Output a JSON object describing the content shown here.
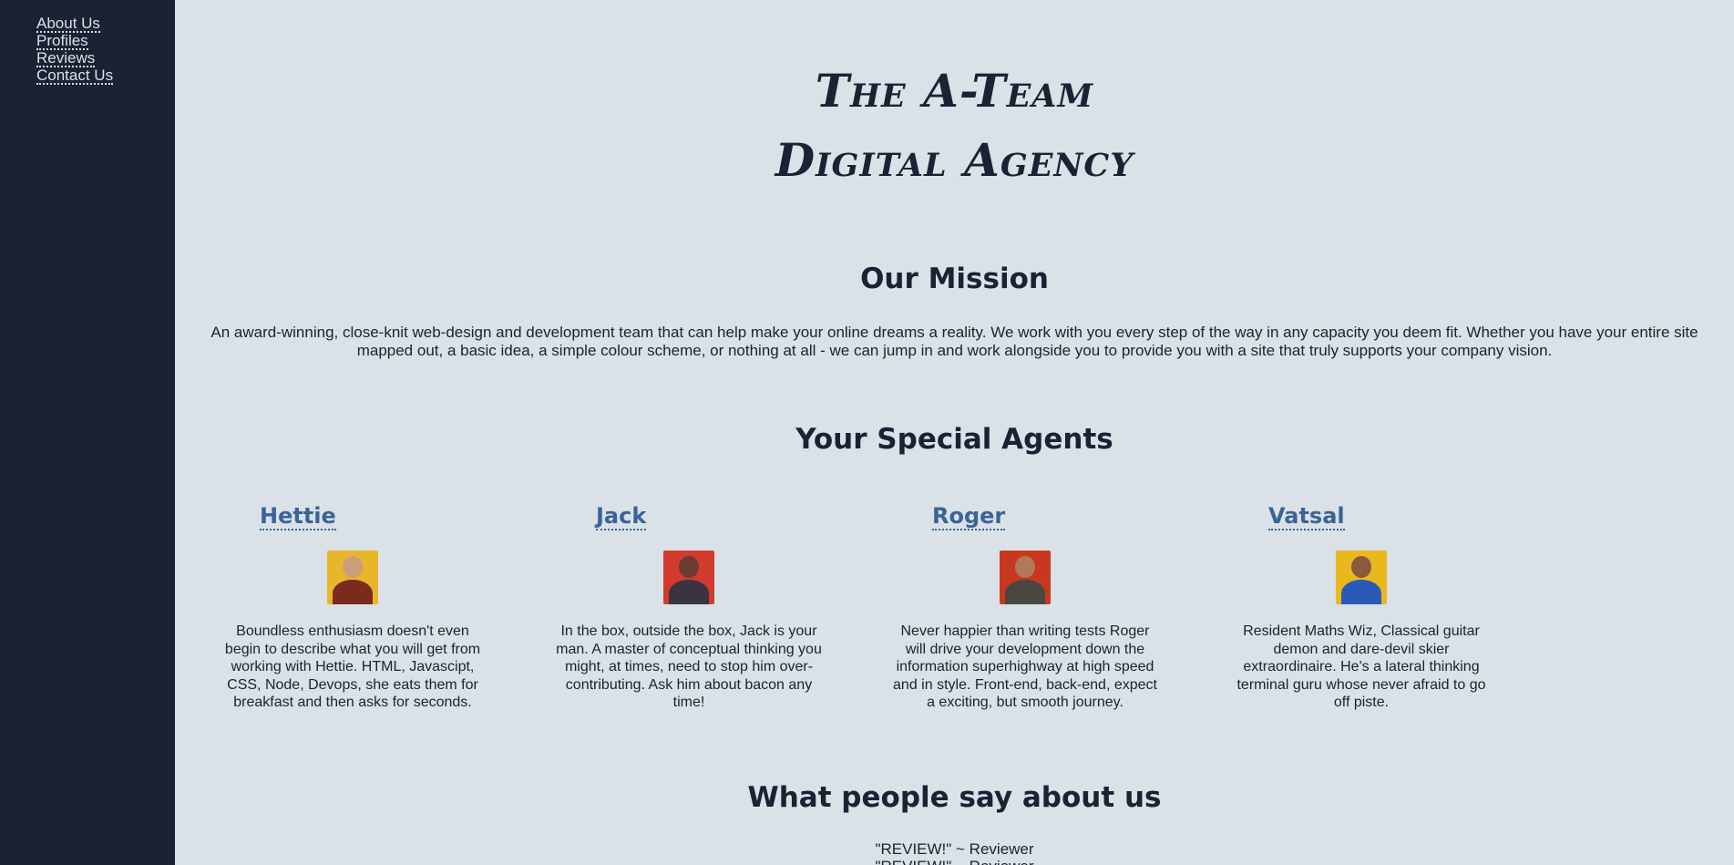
{
  "nav": {
    "items": [
      {
        "label": "About Us"
      },
      {
        "label": "Profiles"
      },
      {
        "label": "Reviews"
      },
      {
        "label": "Contact Us"
      }
    ]
  },
  "header": {
    "title_line1": "The A-Team",
    "title_line2": "Digital Agency"
  },
  "mission": {
    "heading": "Our Mission",
    "text": "An award-winning, close-knit web-design and development team that can help make your online dreams a reality. We work with you every step of the way in any capacity you deem fit. Whether you have your entire site mapped out, a basic idea, a simple colour scheme, or nothing at all - we can jump in and work alongside you to provide you with a site that truly supports your company vision."
  },
  "agents": {
    "heading": "Your Special Agents",
    "items": [
      {
        "name": "Hettie",
        "bio": "Boundless enthusiasm doesn't even begin to describe what you will get from working with Hettie. HTML, Javascipt, CSS, Node, Devops, she eats them for breakfast and then asks for seconds.",
        "photo_bg": "#e7b62a",
        "photo_head": "#c9a07a",
        "photo_body": "#7a2a1e"
      },
      {
        "name": "Jack",
        "bio": "In the box, outside the box, Jack is your man. A master of conceptual thinking you might, at times, need to stop him over-contributing. Ask him about bacon any time!",
        "photo_bg": "#d23a2e",
        "photo_head": "#6b3c32",
        "photo_body": "#3a3440"
      },
      {
        "name": "Roger",
        "bio": "Never happier than writing tests Roger will drive your development down the information superhighway at high speed and in style. Front-end, back-end, expect a exciting, but smooth journey.",
        "photo_bg": "#c8381f",
        "photo_head": "#b07a5a",
        "photo_body": "#4a4642"
      },
      {
        "name": "Vatsal",
        "bio": "Resident Maths Wiz, Classical guitar demon and dare-devil skier extraordinaire. He's a lateral thinking terminal guru whose never afraid to go off piste.",
        "photo_bg": "#e8b81e",
        "photo_head": "#8a5a3a",
        "photo_body": "#2a5ab8"
      }
    ]
  },
  "reviews": {
    "heading": "What people say about us",
    "items": [
      {
        "text": "\"REVIEW!\" ~ Reviewer"
      },
      {
        "text": "\"REVIEW!\" ~ Reviewer"
      }
    ]
  },
  "colors": {
    "sidebar_bg": "#1a2233",
    "page_bg": "#dae1e7",
    "accent": "#3a6496",
    "text": "#1a2233"
  }
}
